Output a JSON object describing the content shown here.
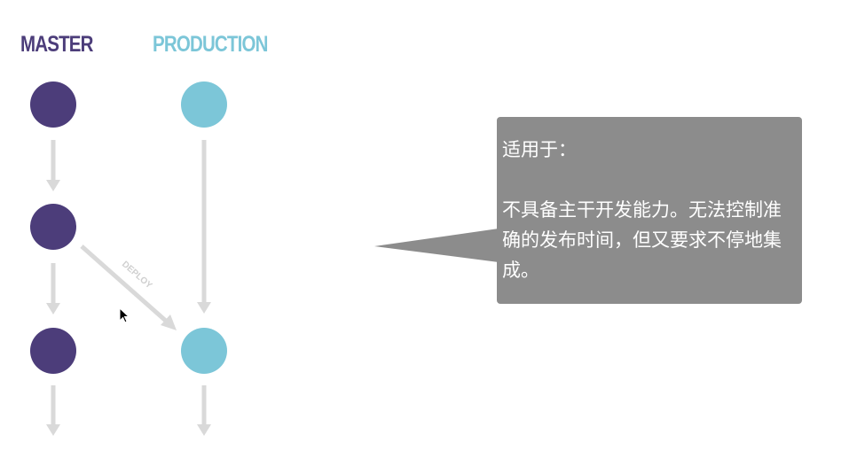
{
  "diagram": {
    "master_label": "MASTER",
    "production_label": "PRODUCTION",
    "deploy_label": "DEPLOY",
    "colors": {
      "master": "#4c3d7a",
      "production": "#7cc6d8",
      "arrow": "#d9d9d9",
      "callout": "#8c8c8c"
    }
  },
  "callout": {
    "heading": "适用于：",
    "body": "不具备主干开发能力。无法控制准确的发布时间，但又要求不停地集成。"
  },
  "cursor": {
    "icon": "mouse-pointer-icon"
  }
}
